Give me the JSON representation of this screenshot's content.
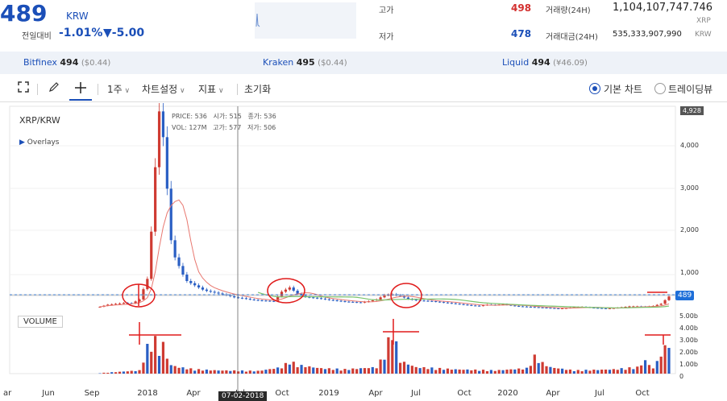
{
  "header": {
    "price": "489",
    "price_unit": "KRW",
    "change_label": "전일대비",
    "change_pct": "-1.01%",
    "change_abs": "▼-5.00",
    "high_label": "고가",
    "high_value": "498",
    "low_label": "저가",
    "low_value": "478",
    "volume_label": "거래량(24H)",
    "volume_value": "1,104,107,747.746",
    "volume_unit": "XRP",
    "amount_label": "거래대금(24H)",
    "amount_value": "535,333,907,990",
    "amount_unit": "KRW"
  },
  "exchanges": [
    {
      "name": "Bitfinex",
      "price": "494",
      "paren": "($0.44)"
    },
    {
      "name": "Kraken",
      "price": "495",
      "paren": "($0.44)"
    },
    {
      "name": "Liquid",
      "price": "494",
      "paren": "(¥46.09)"
    }
  ],
  "toolbar": {
    "interval": "1주",
    "chart_settings": "차트설정",
    "indicators": "지표",
    "reset": "초기화",
    "basic_chart": "기본 차트",
    "trading_view": "트레이딩뷰"
  },
  "chart_data": {
    "type": "candlestick",
    "symbol": "XRP/KRW",
    "overlays_label": "Overlays",
    "ohlc_legend": {
      "price_label": "PRICE:",
      "price": "536",
      "open_label": "시가:",
      "open": "515",
      "close_label": "종가:",
      "close": "536",
      "vol_label": "VOL:",
      "vol": "127M",
      "high_label": "고가:",
      "high": "577",
      "low_label": "저가:",
      "low": "506"
    },
    "y_ticks": [
      "4,000",
      "3,000",
      "2,000",
      "1,000"
    ],
    "y_top_tag": "4,928",
    "last_price_tag": "489",
    "volume_label": "VOLUME",
    "volume_ticks": [
      "5.00b",
      "4.00b",
      "3.00b",
      "2.00b",
      "1.00b",
      "0"
    ],
    "x_ticks": [
      "ar",
      "Jun",
      "Sep",
      "2018",
      "Apr",
      "Jul",
      "Oct",
      "2019",
      "Apr",
      "Jul",
      "Oct",
      "2020",
      "Apr",
      "Jul",
      "Oct"
    ],
    "crosshair_date": "07-02-2018",
    "price_series": [
      [
        0,
        250
      ],
      [
        2,
        300
      ],
      [
        4,
        320
      ],
      [
        6,
        340
      ],
      [
        8,
        330
      ],
      [
        10,
        420
      ],
      [
        12,
        900
      ],
      [
        13,
        2000
      ],
      [
        14,
        3500
      ],
      [
        15,
        4800
      ],
      [
        16,
        4200
      ],
      [
        17,
        3000
      ],
      [
        18,
        1800
      ],
      [
        19,
        1400
      ],
      [
        20,
        1200
      ],
      [
        21,
        1000
      ],
      [
        22,
        850
      ],
      [
        23,
        800
      ],
      [
        24,
        750
      ],
      [
        25,
        700
      ],
      [
        26,
        650
      ],
      [
        27,
        620
      ],
      [
        28,
        600
      ],
      [
        30,
        560
      ],
      [
        32,
        520
      ],
      [
        34,
        470
      ],
      [
        36,
        450
      ],
      [
        38,
        420
      ],
      [
        40,
        400
      ],
      [
        42,
        390
      ],
      [
        44,
        380
      ],
      [
        46,
        600
      ],
      [
        48,
        700
      ],
      [
        50,
        550
      ],
      [
        52,
        480
      ],
      [
        54,
        460
      ],
      [
        56,
        440
      ],
      [
        58,
        410
      ],
      [
        60,
        390
      ],
      [
        62,
        370
      ],
      [
        64,
        360
      ],
      [
        66,
        350
      ],
      [
        68,
        380
      ],
      [
        70,
        420
      ],
      [
        72,
        520
      ],
      [
        74,
        540
      ],
      [
        76,
        500
      ],
      [
        78,
        430
      ],
      [
        80,
        400
      ],
      [
        82,
        390
      ],
      [
        84,
        380
      ],
      [
        86,
        360
      ],
      [
        88,
        340
      ],
      [
        90,
        320
      ],
      [
        92,
        300
      ],
      [
        94,
        280
      ],
      [
        96,
        270
      ],
      [
        98,
        300
      ],
      [
        100,
        290
      ],
      [
        102,
        310
      ],
      [
        104,
        280
      ],
      [
        106,
        260
      ],
      [
        108,
        250
      ],
      [
        110,
        240
      ],
      [
        112,
        230
      ],
      [
        114,
        220
      ],
      [
        116,
        210
      ],
      [
        118,
        220
      ],
      [
        120,
        240
      ],
      [
        122,
        250
      ],
      [
        124,
        230
      ],
      [
        126,
        220
      ],
      [
        128,
        210
      ],
      [
        130,
        220
      ],
      [
        132,
        240
      ],
      [
        134,
        260
      ],
      [
        136,
        260
      ],
      [
        138,
        250
      ],
      [
        140,
        270
      ],
      [
        142,
        320
      ],
      [
        144,
        489
      ]
    ],
    "volume_series": [
      [
        0,
        0.05
      ],
      [
        10,
        0.3
      ],
      [
        12,
        2.5
      ],
      [
        14,
        3.2
      ],
      [
        15,
        2.0
      ],
      [
        16,
        2.8
      ],
      [
        17,
        1.5
      ],
      [
        18,
        0.8
      ],
      [
        20,
        0.6
      ],
      [
        24,
        0.4
      ],
      [
        30,
        0.3
      ],
      [
        40,
        0.25
      ],
      [
        46,
        0.6
      ],
      [
        48,
        1.2
      ],
      [
        50,
        0.8
      ],
      [
        56,
        0.5
      ],
      [
        62,
        0.4
      ],
      [
        70,
        0.6
      ],
      [
        72,
        1.8
      ],
      [
        74,
        4.3
      ],
      [
        76,
        1.2
      ],
      [
        80,
        0.6
      ],
      [
        90,
        0.4
      ],
      [
        100,
        0.3
      ],
      [
        108,
        0.5
      ],
      [
        110,
        1.6
      ],
      [
        112,
        1.0
      ],
      [
        114,
        0.6
      ],
      [
        120,
        0.3
      ],
      [
        130,
        0.4
      ],
      [
        136,
        0.6
      ],
      [
        138,
        1.2
      ],
      [
        140,
        0.5
      ],
      [
        144,
        3.1
      ]
    ]
  }
}
